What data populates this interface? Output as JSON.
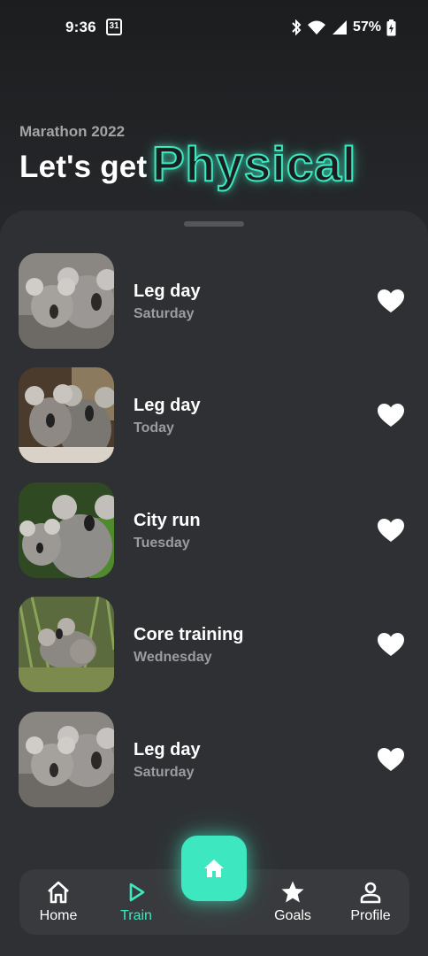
{
  "status_bar": {
    "time": "9:36",
    "calendar_day": "31",
    "battery": "57%",
    "icons": [
      "bluetooth-icon",
      "wifi-icon",
      "signal-icon",
      "battery-icon"
    ]
  },
  "header": {
    "subtitle": "Marathon 2022",
    "title_main": "Let's get",
    "title_highlight": "Physical"
  },
  "workouts": [
    {
      "title": "Leg day",
      "day": "Saturday",
      "favorite": true
    },
    {
      "title": "Leg day",
      "day": "Today",
      "favorite": true
    },
    {
      "title": "City run",
      "day": "Tuesday",
      "favorite": true
    },
    {
      "title": "Core training",
      "day": "Wednesday",
      "favorite": true
    },
    {
      "title": "Leg day",
      "day": "Saturday",
      "favorite": true
    }
  ],
  "nav": {
    "items": [
      {
        "label": "Home",
        "icon": "home-icon",
        "active": false
      },
      {
        "label": "Train",
        "icon": "play-icon",
        "active": true
      },
      {
        "label": "Goals",
        "icon": "star-icon",
        "active": false
      },
      {
        "label": "Profile",
        "icon": "person-icon",
        "active": false
      }
    ],
    "fab_icon": "home-icon"
  },
  "colors": {
    "accent": "#3de8c1",
    "background": "#26272a",
    "sheet": "#2f3033",
    "nav": "#393a3d"
  }
}
